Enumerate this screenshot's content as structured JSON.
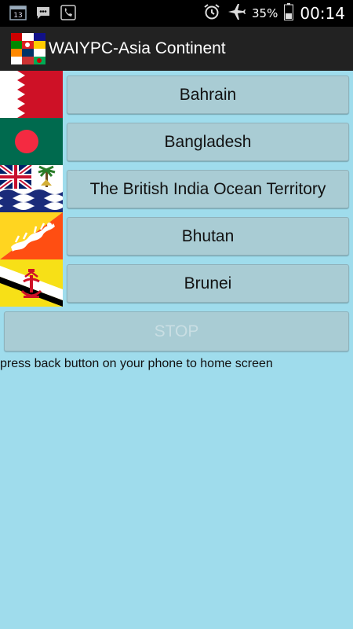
{
  "status_bar": {
    "icons": [
      "calendar-icon",
      "chat-icon",
      "phone-call-icon"
    ],
    "calendar_day": "13",
    "right_icons": [
      "alarm-icon",
      "airplane-icon",
      "battery-icon"
    ],
    "battery_percent": "35%",
    "time": "00:14"
  },
  "app_bar": {
    "title": "WAIYPC-Asia Continent",
    "logo_icon": "flags-collage-icon"
  },
  "countries": [
    {
      "label": "Bahrain",
      "flag_icon": "bahrain-flag-icon"
    },
    {
      "label": "Bangladesh",
      "flag_icon": "bangladesh-flag-icon"
    },
    {
      "label": "The British India Ocean Territory",
      "flag_icon": "biot-flag-icon"
    },
    {
      "label": "Bhutan",
      "flag_icon": "bhutan-flag-icon"
    },
    {
      "label": "Brunei",
      "flag_icon": "brunei-flag-icon"
    }
  ],
  "stop_button": {
    "label": "STOP"
  },
  "hint_text": "press back button on your phone to home screen",
  "colors": {
    "background": "#9fdcec",
    "button": "#a9ccd4",
    "app_bar": "#222222",
    "status_bar": "#000000"
  }
}
